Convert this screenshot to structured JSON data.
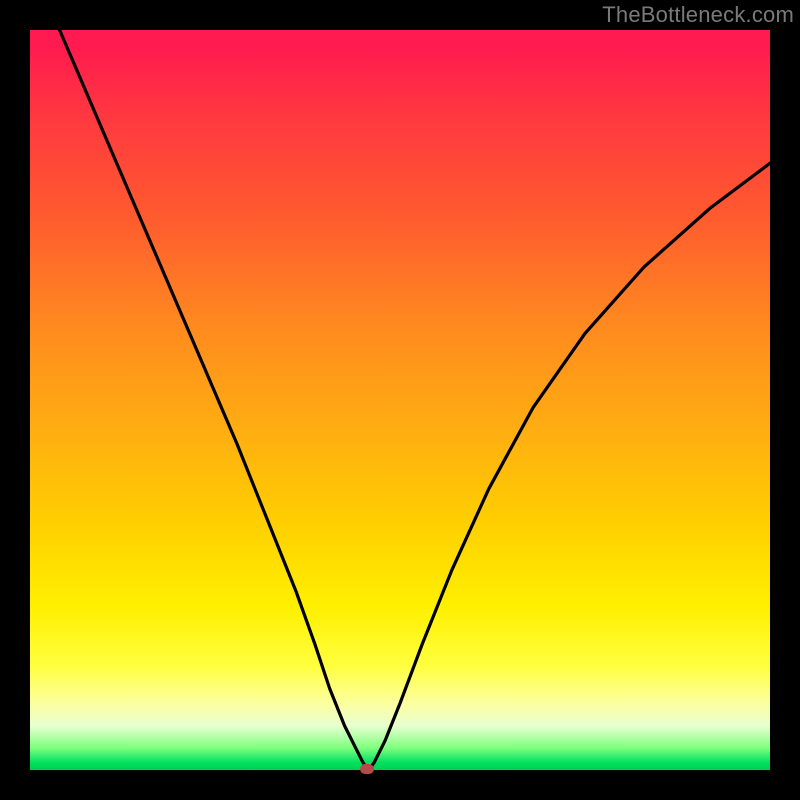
{
  "watermark": "TheBottleneck.com",
  "chart_data": {
    "type": "line",
    "title": "",
    "xlabel": "",
    "ylabel": "",
    "xlim": [
      0,
      100
    ],
    "ylim": [
      0,
      100
    ],
    "series": [
      {
        "name": "curve",
        "x": [
          4,
          10,
          16,
          22,
          28,
          32,
          36,
          38.5,
          40.5,
          42.5,
          44,
          45,
          45.5,
          46,
          46.5,
          48,
          50,
          53,
          57,
          62,
          68,
          75,
          83,
          92,
          100
        ],
        "y": [
          100,
          86,
          72,
          58,
          44,
          34,
          24,
          17,
          11,
          6,
          3,
          1,
          0.3,
          0.3,
          1,
          4,
          9,
          17,
          27,
          38,
          49,
          59,
          68,
          76,
          82
        ]
      }
    ],
    "marker": {
      "x": 45.5,
      "y": 0.2
    },
    "colors": {
      "curve": "#000000",
      "marker": "#b54a4a",
      "gradient_top": "#ff1a4f",
      "gradient_bottom": "#00d050"
    }
  }
}
